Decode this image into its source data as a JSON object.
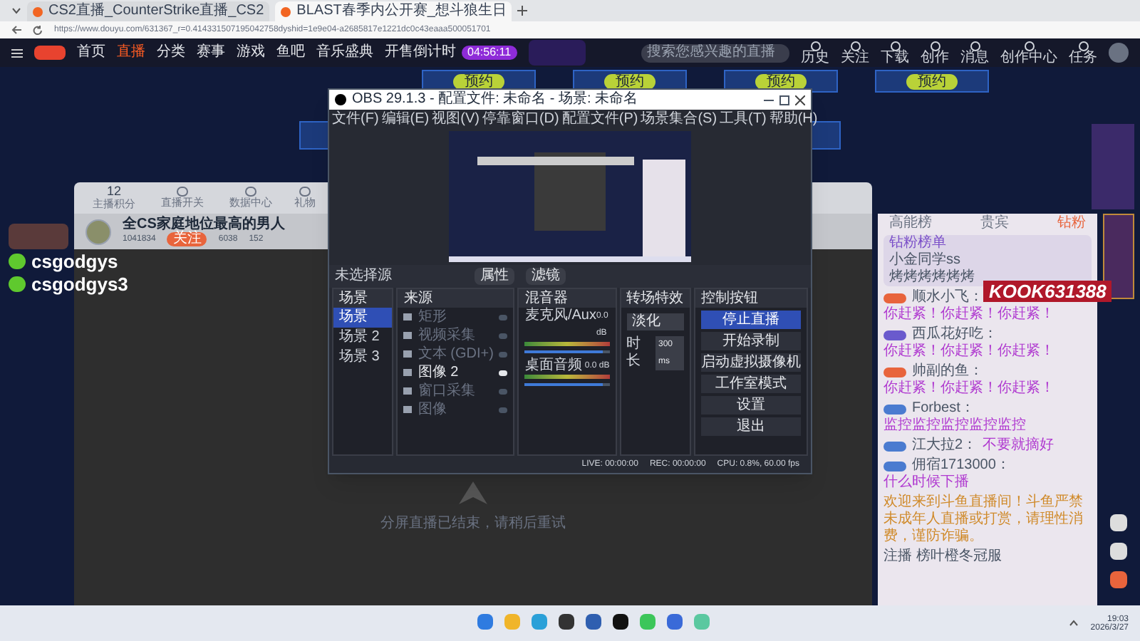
{
  "browser": {
    "tabs": [
      {
        "label": "CS2直播_CounterStrike直播_CS2",
        "selected": false
      },
      {
        "label": "BLAST春季内公开赛_想斗狼生日",
        "selected": true
      }
    ],
    "url": "https://www.douyu.com/631367_r=0.414331507195042758dyshid=1e9e04-a2685817e1221dc0c43eaaa500051701"
  },
  "site_nav": {
    "items": [
      {
        "label": "首页",
        "selected": false
      },
      {
        "label": "直播",
        "selected": true
      },
      {
        "label": "分类",
        "selected": false
      },
      {
        "label": "赛事",
        "selected": false
      },
      {
        "label": "游戏",
        "selected": false
      },
      {
        "label": "鱼吧",
        "selected": false
      },
      {
        "label": "音乐盛典",
        "selected": false
      }
    ],
    "countdown": {
      "label": "开售倒计时",
      "time": "04:56:11"
    },
    "search": {
      "placeholder": "搜索您感兴趣的直播"
    },
    "actions": [
      "历史",
      "关注",
      "下载",
      "创作",
      "消息",
      "创作中心",
      "任务"
    ]
  },
  "banners": [
    "预约",
    "预约",
    "预约",
    "预约"
  ],
  "room": {
    "score": "12",
    "score_label": "主播积分",
    "toolbar": [
      "直播开关",
      "数据中心",
      "礼物"
    ],
    "title": "全CS家庭地位最高的男人",
    "id": "1041834",
    "follow": "关注",
    "stats": [
      "6038",
      "152"
    ]
  },
  "overlay_ids": [
    "csgodgys",
    "csgodgys3"
  ],
  "player": {
    "notice": "分屏直播已结束，请稍后重试"
  },
  "obs": {
    "title": "OBS 29.1.3 - 配置文件: 未命名 - 场景: 未命名",
    "menu": [
      "文件(F)",
      "编辑(E)",
      "视图(V)",
      "停靠窗口(D)",
      "配置文件(P)",
      "场景集合(S)",
      "工具(T)",
      "帮助(H)"
    ],
    "source_bar": {
      "label": "未选择源",
      "buttons": [
        "属性",
        "滤镜"
      ]
    },
    "scenes": {
      "title": "场景",
      "items": [
        {
          "label": "场景",
          "selected": true
        },
        {
          "label": "场景 2",
          "selected": false
        },
        {
          "label": "场景 3",
          "selected": false
        }
      ]
    },
    "sources": {
      "title": "来源",
      "items": [
        {
          "label": "矩形",
          "visible": false
        },
        {
          "label": "视频采集",
          "visible": false
        },
        {
          "label": "文本 (GDI+)",
          "visible": false
        },
        {
          "label": "图像 2",
          "visible": true
        },
        {
          "label": "窗口采集",
          "visible": false
        },
        {
          "label": "图像",
          "visible": false
        }
      ]
    },
    "mixer": {
      "title": "混音器",
      "channels": [
        {
          "name": "麦克风/Aux",
          "reading": "0.0 dB",
          "level": 0.92
        },
        {
          "name": "桌面音频",
          "reading": "0.0 dB",
          "level": 0.92
        }
      ]
    },
    "transitions": {
      "title": "转场特效",
      "type": "淡化",
      "duration_label": "时长",
      "duration": "300 ms"
    },
    "controls": {
      "title": "控制按钮",
      "buttons": [
        {
          "label": "停止直播",
          "selected": true
        },
        {
          "label": "开始录制",
          "selected": false
        },
        {
          "label": "启动虚拟摄像机",
          "selected": false
        },
        {
          "label": "工作室模式",
          "selected": false
        },
        {
          "label": "设置",
          "selected": false
        },
        {
          "label": "退出",
          "selected": false
        }
      ]
    },
    "status": {
      "live": "LIVE: 00:00:00",
      "rec": "REC: 00:00:00",
      "cpu": "CPU: 0.8%, 60.00 fps"
    }
  },
  "chat": {
    "tabs": [
      {
        "label": "高能榜",
        "selected": false
      },
      {
        "label": "贵宾",
        "selected": false
      },
      {
        "label": "钻粉",
        "selected": true
      }
    ],
    "rank_title": "钻粉榜单",
    "rank": [
      "小金同学ss",
      "烤烤烤烤烤烤"
    ],
    "messages": [
      {
        "user": "顺水小飞：",
        "text": "你赶紧！你赶紧！你赶紧！",
        "color": "#e8643c"
      },
      {
        "user": "西瓜花好吃：",
        "text": "你赶紧！你赶紧！你赶紧！",
        "color": "#6a5acd"
      },
      {
        "user": "帅副的鱼：",
        "text": "你赶紧！你赶紧！你赶紧！",
        "color": "#e8643c"
      },
      {
        "user": "Forbest：",
        "text": "监控监控监控监控监控",
        "color": "#4a7bd0"
      },
      {
        "user": "江大拉2：",
        "text": "不要就摘好",
        "color": "#4a7bd0"
      },
      {
        "user": "佣宿1713000：",
        "text": "什么时候下播",
        "color": "#4a7bd0"
      }
    ],
    "notice": "欢迎来到斗鱼直播间！斗鱼严禁未成年人直播或打赏，请理性消费，谨防诈骗。",
    "footer": "注播 榜叶橙冬冠服"
  },
  "promo": "KOOK631388",
  "taskbar": {
    "time": "19:03",
    "date": "2026/3/27"
  }
}
